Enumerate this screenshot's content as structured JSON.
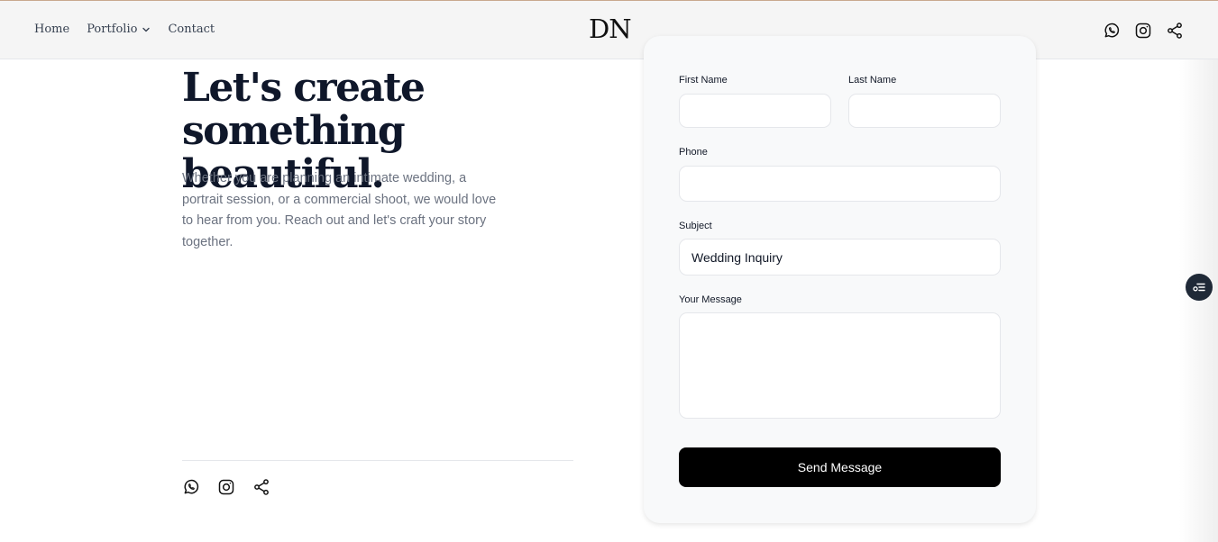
{
  "header": {
    "nav": [
      {
        "label": "Home"
      },
      {
        "label": "Portfolio"
      },
      {
        "label": "Contact"
      }
    ],
    "logo": "DN",
    "social_icons": [
      "whatsapp-icon",
      "instagram-icon",
      "share-icon"
    ]
  },
  "hero": {
    "title": "Let's create something beautiful.",
    "description": "Whether you are planning an intimate wedding, a portrait session, or a commercial shoot, we would love to hear from you. Reach out and let's craft your story together."
  },
  "form": {
    "first_name_label": "First Name",
    "first_name_value": "",
    "last_name_label": "Last Name",
    "last_name_value": "",
    "phone_label": "Phone",
    "phone_value": "",
    "subject_label": "Subject",
    "subject_value": "Wedding Inquiry",
    "message_label": "Your Message",
    "message_value": "",
    "submit_label": "Send Message"
  },
  "colors": {
    "accent": "#000000",
    "header_bg": "#f5f5f5",
    "card_bg": "#f8f9fa",
    "title": "#0f172a",
    "body_text": "#6b7280"
  }
}
